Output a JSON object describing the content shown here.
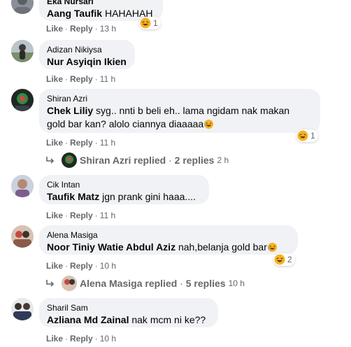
{
  "comments": [
    {
      "author": "Eka Nursari",
      "tag": "Aang Taufik",
      "text": "HAHAHAH",
      "like": "Like",
      "reply": "Reply",
      "time": "13 h",
      "reaction_count": "1",
      "avatar": "avatar-photo"
    },
    {
      "author": "Adizan Nikiysa",
      "tag": "Nur Asyiqin Ikien",
      "text": "",
      "like": "Like",
      "reply": "Reply",
      "time": "11 h",
      "avatar": "avatar-photo"
    },
    {
      "author": "Shiran Azri",
      "tag": "Chek Liliy",
      "text_line1": "syg.. nnti b beli eh.. lama ngidam nak makan",
      "text_line2": "gold bar kan? alolo ciannya diaaaaa",
      "like": "Like",
      "reply": "Reply",
      "time": "11 h",
      "reaction_count": "1",
      "replies_author": "Shiran Azri",
      "replies_action": "replied",
      "replies_count": "2 replies",
      "replies_time": "2 h",
      "avatar": "avatar-photo"
    },
    {
      "author": "Cik Intan",
      "tag": "Taufik Matz",
      "text": "jgn prank gini haaa....",
      "like": "Like",
      "reply": "Reply",
      "time": "11 h",
      "avatar": "avatar-photo"
    },
    {
      "author": "Alena Masiga",
      "tag": "Noor Tiniy Watie Abdul Aziz",
      "text": "nah,belanja gold bar",
      "like": "Like",
      "reply": "Reply",
      "time": "10 h",
      "reaction_count": "2",
      "replies_author": "Alena Masiga",
      "replies_action": "replied",
      "replies_count": "5 replies",
      "replies_time": "10 h",
      "avatar": "avatar-photo"
    },
    {
      "author": "Sharil Sam",
      "tag": "Azliana Md Zainal",
      "text": "nak mcm ni ke??",
      "like": "Like",
      "reply": "Reply",
      "time": "10 h",
      "avatar": "avatar-photo"
    }
  ],
  "colors": {
    "bubble": "#f0f2f5",
    "meta_text": "#65676b",
    "text": "#050505",
    "haha_face": "#f7b125"
  },
  "icons": [
    "haha-reaction-icon",
    "reply-arrow-icon",
    "rofl-emoji-icon"
  ]
}
